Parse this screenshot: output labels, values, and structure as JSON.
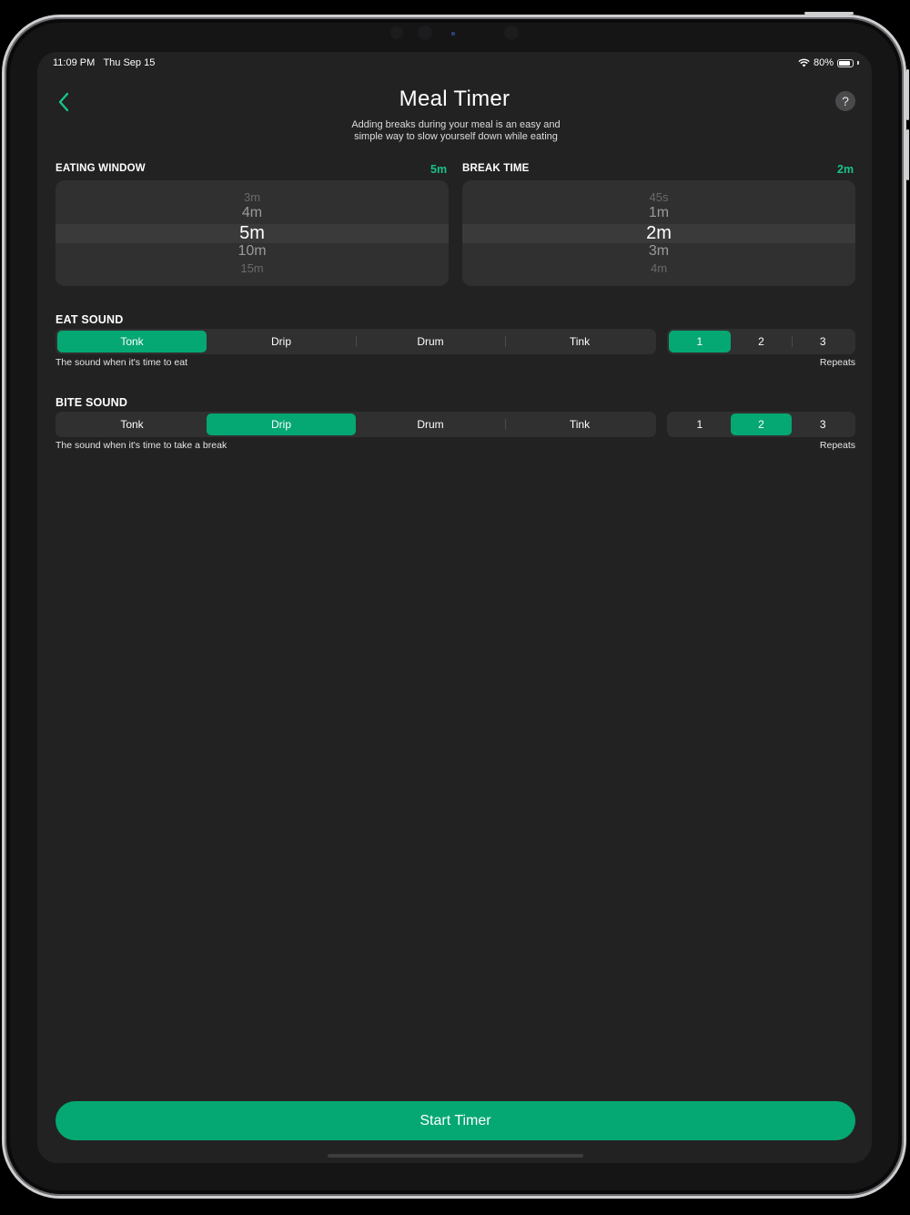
{
  "status_bar": {
    "time": "11:09 PM",
    "date": "Thu Sep 15",
    "battery": "80%"
  },
  "header": {
    "title": "Meal Timer",
    "subtitle_line1": "Adding breaks during your meal is an easy and",
    "subtitle_line2": "simple way to slow yourself down while eating",
    "help_label": "?"
  },
  "eating_window": {
    "label": "EATING WINDOW",
    "value": "5m",
    "options": [
      "3m",
      "4m",
      "5m",
      "10m",
      "15m"
    ]
  },
  "break_time": {
    "label": "BREAK TIME",
    "value": "2m",
    "options": [
      "45s",
      "1m",
      "2m",
      "3m",
      "4m"
    ]
  },
  "eat_sound": {
    "label": "EAT SOUND",
    "sounds": [
      "Tonk",
      "Drip",
      "Drum",
      "Tink"
    ],
    "selected_sound": "Tonk",
    "repeats": [
      "1",
      "2",
      "3"
    ],
    "selected_repeat": "1",
    "helper": "The sound when it's time to eat",
    "repeats_label": "Repeats"
  },
  "bite_sound": {
    "label": "BITE SOUND",
    "sounds": [
      "Tonk",
      "Drip",
      "Drum",
      "Tink"
    ],
    "selected_sound": "Drip",
    "repeats": [
      "1",
      "2",
      "3"
    ],
    "selected_repeat": "2",
    "helper": "The sound when it's time to take a break",
    "repeats_label": "Repeats"
  },
  "start_button": {
    "label": "Start Timer"
  },
  "colors": {
    "accent": "#05a773",
    "value_text": "#19c28a",
    "background": "#222222",
    "control": "#303030"
  },
  "icons": {
    "back": "chevron-left-icon",
    "help": "question-icon",
    "wifi": "wifi-icon",
    "battery": "battery-icon"
  }
}
